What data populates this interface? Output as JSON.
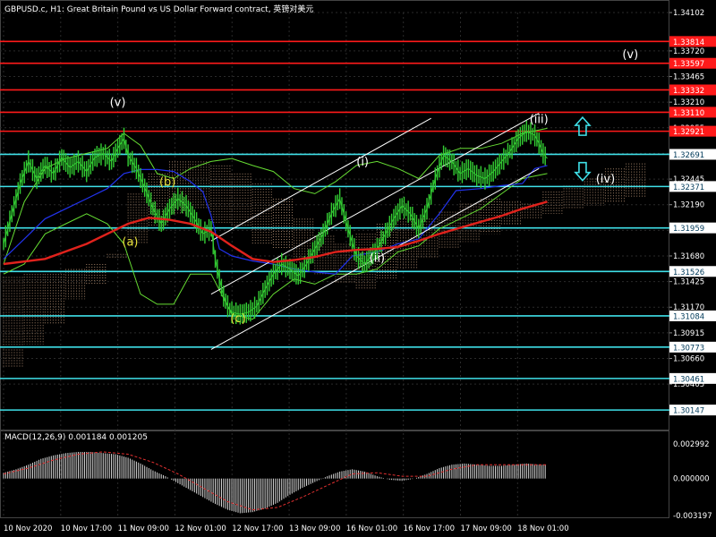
{
  "header": {
    "title": "GBPUSD.c, H1:  Great Britain Pound vs US Dollar Forward contract, 英镑对美元"
  },
  "colors": {
    "background": "#000000",
    "grid": "#2a2a2a",
    "axis_text": "#ffffff",
    "red_level": "#ff1a1a",
    "cyan_level": "#3fe0e8",
    "price": "#33cc33",
    "ma_red": "#e0221c",
    "ma_blue": "#2233ee",
    "envelope": "#66dd33",
    "cloud": "#c8a080",
    "channel": "#ffffff",
    "wave_white": "#ffffff",
    "wave_yellow": "#e8e23a",
    "arrow": "#3fe0e8",
    "macd_hist": "#d8d8d8",
    "macd_signal": "#e03030"
  },
  "chart_data": {
    "type": "line",
    "symbol": "GBPUSD.c",
    "timeframe": "H1",
    "ylim": [
      1.2997,
      1.34102
    ],
    "y_ticks": [
      1.34102,
      1.3372,
      1.33465,
      1.3321,
      1.32955,
      1.327,
      1.32445,
      1.3219,
      1.31935,
      1.3168,
      1.31425,
      1.3117,
      1.30915,
      1.3066,
      1.30405
    ],
    "x_ticks": [
      "10 Nov 2020",
      "10 Nov 17:00",
      "11 Nov 09:00",
      "12 Nov 01:00",
      "12 Nov 17:00",
      "13 Nov 09:00",
      "16 Nov 01:00",
      "16 Nov 17:00",
      "17 Nov 09:00",
      "18 Nov 01:00"
    ],
    "horizontal_levels": [
      {
        "value": 1.33814,
        "label": "1.33814",
        "kind": "red"
      },
      {
        "value": 1.33597,
        "label": "1.33597",
        "kind": "red"
      },
      {
        "value": 1.33332,
        "label": "1.33332",
        "kind": "red"
      },
      {
        "value": 1.3311,
        "label": "1.33110",
        "kind": "red"
      },
      {
        "value": 1.32921,
        "label": "1.32921",
        "kind": "red"
      },
      {
        "value": 1.32691,
        "label": "1.32691",
        "kind": "cyan"
      },
      {
        "value": 1.32371,
        "label": "1.32371",
        "kind": "cyan"
      },
      {
        "value": 1.31959,
        "label": "1.31959",
        "kind": "cyan"
      },
      {
        "value": 1.31526,
        "label": "1.31526",
        "kind": "cyan"
      },
      {
        "value": 1.31084,
        "label": "1.31084",
        "kind": "cyan"
      },
      {
        "value": 1.30773,
        "label": "1.30773",
        "kind": "cyan"
      },
      {
        "value": 1.30461,
        "label": "1.30461",
        "kind": "cyan"
      },
      {
        "value": 1.30147,
        "label": "1.30147",
        "kind": "cyan"
      }
    ],
    "current_price": {
      "value": 1.32691,
      "label": "1.32691"
    },
    "price_series": [
      [
        0,
        1.318
      ],
      [
        4,
        1.321
      ],
      [
        8,
        1.324
      ],
      [
        12,
        1.3262
      ],
      [
        16,
        1.3245
      ],
      [
        20,
        1.3258
      ],
      [
        24,
        1.325
      ],
      [
        28,
        1.3266
      ],
      [
        32,
        1.3256
      ],
      [
        36,
        1.3262
      ],
      [
        40,
        1.3252
      ],
      [
        44,
        1.3266
      ],
      [
        48,
        1.327
      ],
      [
        52,
        1.3262
      ],
      [
        55,
        1.3275
      ],
      [
        58,
        1.3285
      ],
      [
        60,
        1.3268
      ],
      [
        64,
        1.3255
      ],
      [
        68,
        1.3236
      ],
      [
        72,
        1.3215
      ],
      [
        76,
        1.32
      ],
      [
        80,
        1.3215
      ],
      [
        84,
        1.3225
      ],
      [
        88,
        1.3218
      ],
      [
        92,
        1.3205
      ],
      [
        96,
        1.319
      ],
      [
        100,
        1.3195
      ],
      [
        102,
        1.3165
      ],
      [
        104,
        1.3145
      ],
      [
        106,
        1.3128
      ],
      [
        108,
        1.3118
      ],
      [
        110,
        1.3112
      ],
      [
        114,
        1.311
      ],
      [
        118,
        1.3112
      ],
      [
        122,
        1.3118
      ],
      [
        126,
        1.3135
      ],
      [
        130,
        1.315
      ],
      [
        134,
        1.316
      ],
      [
        138,
        1.3155
      ],
      [
        142,
        1.3148
      ],
      [
        146,
        1.316
      ],
      [
        150,
        1.3175
      ],
      [
        154,
        1.319
      ],
      [
        158,
        1.321
      ],
      [
        162,
        1.3225
      ],
      [
        166,
        1.3195
      ],
      [
        170,
        1.3168
      ],
      [
        174,
        1.316
      ],
      [
        176,
        1.3165
      ],
      [
        180,
        1.3175
      ],
      [
        184,
        1.319
      ],
      [
        188,
        1.3205
      ],
      [
        192,
        1.3218
      ],
      [
        196,
        1.321
      ],
      [
        200,
        1.3195
      ],
      [
        204,
        1.3215
      ],
      [
        208,
        1.3245
      ],
      [
        212,
        1.3268
      ],
      [
        216,
        1.3262
      ],
      [
        220,
        1.325
      ],
      [
        224,
        1.3255
      ],
      [
        228,
        1.3248
      ],
      [
        232,
        1.3245
      ],
      [
        236,
        1.3252
      ],
      [
        240,
        1.3262
      ],
      [
        244,
        1.3272
      ],
      [
        248,
        1.3285
      ],
      [
        252,
        1.3292
      ],
      [
        256,
        1.3288
      ],
      [
        258,
        1.328
      ],
      [
        260,
        1.327
      ],
      [
        262,
        1.3265
      ]
    ],
    "ma_red_series": [
      [
        0,
        1.316
      ],
      [
        20,
        1.3165
      ],
      [
        40,
        1.318
      ],
      [
        60,
        1.32
      ],
      [
        70,
        1.3206
      ],
      [
        80,
        1.3204
      ],
      [
        90,
        1.32
      ],
      [
        100,
        1.3192
      ],
      [
        110,
        1.3178
      ],
      [
        120,
        1.3165
      ],
      [
        130,
        1.3162
      ],
      [
        140,
        1.3164
      ],
      [
        150,
        1.3167
      ],
      [
        160,
        1.3172
      ],
      [
        170,
        1.3174
      ],
      [
        180,
        1.3175
      ],
      [
        190,
        1.3177
      ],
      [
        200,
        1.3183
      ],
      [
        210,
        1.319
      ],
      [
        220,
        1.3196
      ],
      [
        230,
        1.3202
      ],
      [
        240,
        1.3208
      ],
      [
        250,
        1.3215
      ],
      [
        262,
        1.3222
      ]
    ],
    "ma_blue_series": [
      [
        0,
        1.3165
      ],
      [
        10,
        1.3185
      ],
      [
        20,
        1.3205
      ],
      [
        30,
        1.3215
      ],
      [
        40,
        1.3225
      ],
      [
        50,
        1.3235
      ],
      [
        58,
        1.325
      ],
      [
        66,
        1.3254
      ],
      [
        74,
        1.3254
      ],
      [
        82,
        1.3252
      ],
      [
        90,
        1.3242
      ],
      [
        96,
        1.3232
      ],
      [
        100,
        1.3208
      ],
      [
        104,
        1.3175
      ],
      [
        110,
        1.3168
      ],
      [
        120,
        1.3163
      ],
      [
        130,
        1.316
      ],
      [
        140,
        1.3155
      ],
      [
        150,
        1.3152
      ],
      [
        160,
        1.315
      ],
      [
        168,
        1.3168
      ],
      [
        180,
        1.3172
      ],
      [
        190,
        1.318
      ],
      [
        200,
        1.3185
      ],
      [
        210,
        1.321
      ],
      [
        218,
        1.3233
      ],
      [
        230,
        1.3235
      ],
      [
        240,
        1.3238
      ],
      [
        250,
        1.324
      ],
      [
        256,
        1.3255
      ],
      [
        262,
        1.3258
      ]
    ],
    "envelope_upper": [
      [
        0,
        1.316
      ],
      [
        10,
        1.3222
      ],
      [
        20,
        1.3255
      ],
      [
        30,
        1.3265
      ],
      [
        40,
        1.327
      ],
      [
        50,
        1.3275
      ],
      [
        58,
        1.329
      ],
      [
        66,
        1.3278
      ],
      [
        74,
        1.325
      ],
      [
        82,
        1.3245
      ],
      [
        90,
        1.3255
      ],
      [
        100,
        1.3262
      ],
      [
        110,
        1.3265
      ],
      [
        120,
        1.3258
      ],
      [
        130,
        1.3252
      ],
      [
        140,
        1.3235
      ],
      [
        150,
        1.323
      ],
      [
        160,
        1.3242
      ],
      [
        170,
        1.3258
      ],
      [
        180,
        1.3262
      ],
      [
        190,
        1.3255
      ],
      [
        200,
        1.3245
      ],
      [
        210,
        1.3268
      ],
      [
        220,
        1.3275
      ],
      [
        230,
        1.3275
      ],
      [
        240,
        1.328
      ],
      [
        250,
        1.329
      ],
      [
        262,
        1.3295
      ]
    ],
    "envelope_lower": [
      [
        0,
        1.315
      ],
      [
        10,
        1.316
      ],
      [
        20,
        1.319
      ],
      [
        30,
        1.32
      ],
      [
        40,
        1.321
      ],
      [
        50,
        1.32
      ],
      [
        58,
        1.318
      ],
      [
        66,
        1.313
      ],
      [
        74,
        1.312
      ],
      [
        82,
        1.312
      ],
      [
        90,
        1.315
      ],
      [
        100,
        1.315
      ],
      [
        110,
        1.311
      ],
      [
        120,
        1.3105
      ],
      [
        130,
        1.313
      ],
      [
        140,
        1.3145
      ],
      [
        150,
        1.314
      ],
      [
        160,
        1.315
      ],
      [
        170,
        1.315
      ],
      [
        180,
        1.3155
      ],
      [
        190,
        1.3172
      ],
      [
        200,
        1.3178
      ],
      [
        210,
        1.3195
      ],
      [
        220,
        1.3205
      ],
      [
        230,
        1.3215
      ],
      [
        240,
        1.323
      ],
      [
        250,
        1.3245
      ],
      [
        262,
        1.325
      ]
    ],
    "cloud": [
      [
        0,
        1.3147,
        1.3058
      ],
      [
        10,
        1.315,
        1.308
      ],
      [
        20,
        1.315,
        1.31
      ],
      [
        30,
        1.3155,
        1.3125
      ],
      [
        40,
        1.316,
        1.314
      ],
      [
        50,
        1.317,
        1.3165
      ],
      [
        60,
        1.323,
        1.318
      ],
      [
        70,
        1.325,
        1.3195
      ],
      [
        80,
        1.3262,
        1.321
      ],
      [
        90,
        1.3262,
        1.3215
      ],
      [
        100,
        1.3258,
        1.32
      ],
      [
        110,
        1.325,
        1.3195
      ],
      [
        120,
        1.324,
        1.318
      ],
      [
        130,
        1.3225,
        1.3175
      ],
      [
        140,
        1.3205,
        1.316
      ],
      [
        150,
        1.3188,
        1.315
      ],
      [
        160,
        1.318,
        1.314
      ],
      [
        170,
        1.319,
        1.3135
      ],
      [
        180,
        1.32,
        1.3145
      ],
      [
        190,
        1.3205,
        1.3155
      ],
      [
        200,
        1.3205,
        1.3165
      ],
      [
        210,
        1.3212,
        1.3175
      ],
      [
        220,
        1.322,
        1.3182
      ],
      [
        230,
        1.3225,
        1.319
      ],
      [
        240,
        1.3222,
        1.3198
      ],
      [
        250,
        1.322,
        1.3205
      ],
      [
        260,
        1.3232,
        1.321
      ],
      [
        270,
        1.3238,
        1.3215
      ],
      [
        280,
        1.3245,
        1.3218
      ],
      [
        290,
        1.3255,
        1.3222
      ],
      [
        300,
        1.326,
        1.3226
      ]
    ],
    "channel_lines": [
      [
        [
          100,
          1.313
        ],
        [
          258,
          1.331
        ]
      ],
      [
        [
          100,
          1.3075
        ],
        [
          258,
          1.3255
        ]
      ],
      [
        [
          100,
          1.3183
        ],
        [
          206,
          1.3305
        ]
      ]
    ],
    "wave_labels": [
      {
        "text": "(v)",
        "at": [
          55,
          1.3317
        ],
        "color": "white"
      },
      {
        "text": "(b)",
        "at": [
          79,
          1.3238
        ],
        "color": "yellow"
      },
      {
        "text": "(a)",
        "at": [
          61,
          1.3178
        ],
        "color": "yellow"
      },
      {
        "text": "(c)",
        "at": [
          113,
          1.3102
        ],
        "color": "yellow"
      },
      {
        "text": "(i)",
        "at": [
          173,
          1.3258
        ],
        "color": "white"
      },
      {
        "text": "(ii)",
        "at": [
          180,
          1.3162
        ],
        "color": "white"
      },
      {
        "text": "(iii)",
        "at": [
          258,
          1.33
        ],
        "color": "white"
      },
      {
        "text": "(iv)",
        "at": [
          290,
          1.3241
        ],
        "color": "white"
      },
      {
        "text": "(v)",
        "at": [
          302,
          1.3365
        ],
        "color": "white"
      }
    ],
    "arrows": [
      {
        "direction": "up",
        "at": [
          279,
          1.3297
        ]
      },
      {
        "direction": "down",
        "at": [
          279,
          1.3252
        ]
      }
    ],
    "macd": {
      "label": "MACD(12,26,9) 0.001184 0.001205",
      "ylim": [
        -0.003197,
        0.002992
      ],
      "y_ticks": [
        0.002992,
        0.0,
        -0.003197
      ],
      "y_tick_labels": [
        "0.002992",
        "0.000000",
        "-0.003197"
      ],
      "histogram": [
        [
          0,
          0.0005
        ],
        [
          6,
          0.0008
        ],
        [
          12,
          0.0012
        ],
        [
          18,
          0.0017
        ],
        [
          24,
          0.002
        ],
        [
          30,
          0.0022
        ],
        [
          36,
          0.0023
        ],
        [
          42,
          0.0023
        ],
        [
          48,
          0.0022
        ],
        [
          54,
          0.0021
        ],
        [
          60,
          0.0018
        ],
        [
          66,
          0.0013
        ],
        [
          72,
          0.0007
        ],
        [
          78,
          0.0002
        ],
        [
          84,
          -0.0004
        ],
        [
          90,
          -0.001
        ],
        [
          96,
          -0.0016
        ],
        [
          102,
          -0.0022
        ],
        [
          108,
          -0.0027
        ],
        [
          114,
          -0.003
        ],
        [
          120,
          -0.0029
        ],
        [
          126,
          -0.0026
        ],
        [
          132,
          -0.0021
        ],
        [
          138,
          -0.0014
        ],
        [
          144,
          -0.0008
        ],
        [
          150,
          -0.0003
        ],
        [
          156,
          0.0002
        ],
        [
          162,
          0.0006
        ],
        [
          168,
          0.0008
        ],
        [
          174,
          0.0006
        ],
        [
          180,
          0.0002
        ],
        [
          186,
          -0.0001
        ],
        [
          192,
          -0.0002
        ],
        [
          198,
          0.0
        ],
        [
          204,
          0.0004
        ],
        [
          210,
          0.0009
        ],
        [
          216,
          0.0012
        ],
        [
          222,
          0.0013
        ],
        [
          228,
          0.0012
        ],
        [
          234,
          0.0011
        ],
        [
          240,
          0.0011
        ],
        [
          246,
          0.0012
        ],
        [
          252,
          0.0013
        ],
        [
          258,
          0.0012
        ],
        [
          262,
          0.0012
        ]
      ],
      "signal": [
        [
          0,
          0.0004
        ],
        [
          12,
          0.0009
        ],
        [
          24,
          0.0016
        ],
        [
          36,
          0.0021
        ],
        [
          48,
          0.0023
        ],
        [
          60,
          0.0021
        ],
        [
          72,
          0.0014
        ],
        [
          84,
          0.0004
        ],
        [
          96,
          -0.0008
        ],
        [
          108,
          -0.002
        ],
        [
          120,
          -0.0027
        ],
        [
          132,
          -0.0025
        ],
        [
          144,
          -0.0016
        ],
        [
          156,
          -0.0006
        ],
        [
          168,
          0.0004
        ],
        [
          180,
          0.0005
        ],
        [
          192,
          0.0002
        ],
        [
          204,
          0.0002
        ],
        [
          216,
          0.0008
        ],
        [
          228,
          0.0012
        ],
        [
          240,
          0.0012
        ],
        [
          252,
          0.0012
        ],
        [
          262,
          0.0012
        ]
      ]
    }
  }
}
